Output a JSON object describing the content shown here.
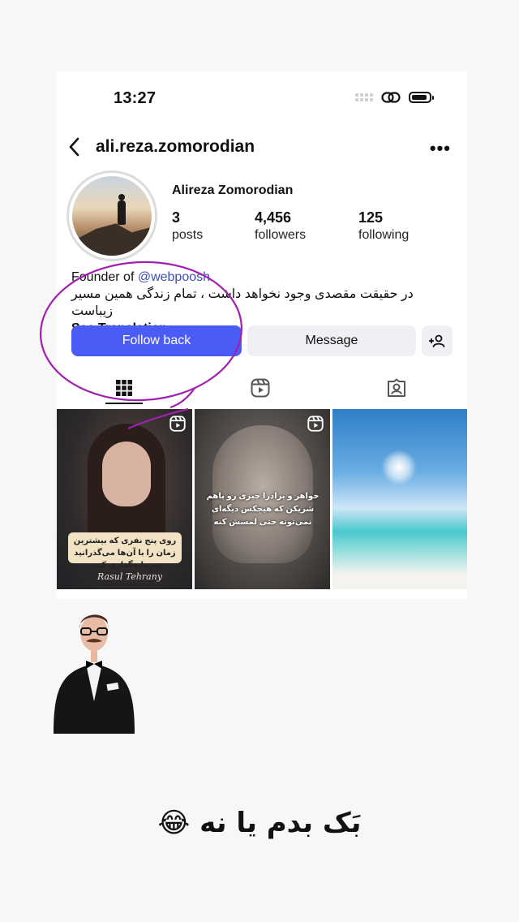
{
  "status_bar": {
    "time": "13:27"
  },
  "profile": {
    "username": "ali.reza.zomorodian",
    "display_name": "Alireza Zomorodian",
    "stats": [
      {
        "value": "3",
        "label": "posts"
      },
      {
        "value": "4,456",
        "label": "followers"
      },
      {
        "value": "125",
        "label": "following"
      }
    ],
    "bio": {
      "prefix": "Founder of ",
      "link": "@webpoosh",
      "persian_line": "در حقیقت مقصدی وجود نخواهد داشت ، تمام زندگی همین مسیر زیباست",
      "see_translation": "See Translation"
    }
  },
  "actions": {
    "follow_back": "Follow back",
    "message": "Message"
  },
  "tabs": [
    "grid-icon",
    "reels-icon",
    "tagged-icon"
  ],
  "posts": [
    {
      "caption": "روی پنج نفری که بیشترین زمان را با آن‌ها می‌گذرانید سرمایه‌گذاری کنید.",
      "signature": "Rasul Tehrany"
    },
    {
      "caption": "خواهر و برادرا چیزی رو باهم شریکن که هیچکس دیگه‌ای نمی‌تونه حتی لمسش کنه"
    },
    {
      "caption": ""
    }
  ],
  "story_text": "بَک بدم یا نه 😂",
  "colors": {
    "accent": "#4b5cf5",
    "annotation": "#a020b0",
    "link": "#3b4fb8"
  }
}
